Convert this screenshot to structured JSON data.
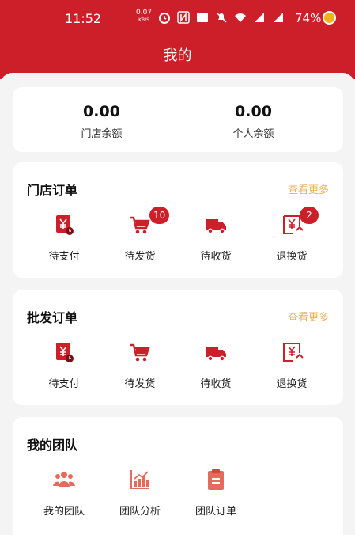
{
  "status_bar": {
    "time": "11:52",
    "net_speed_value": "0.07",
    "net_speed_unit": "KB/S",
    "battery": "74%"
  },
  "page_title": "我的",
  "balance": {
    "store_amount": "0.00",
    "store_label": "门店余额",
    "personal_amount": "0.00",
    "personal_label": "个人余额"
  },
  "store_orders": {
    "title": "门店订单",
    "more": "查看更多",
    "items": [
      {
        "label": "待支付",
        "icon": "pending-payment-icon",
        "badge": ""
      },
      {
        "label": "待发货",
        "icon": "cart-icon",
        "badge": "10"
      },
      {
        "label": "待收货",
        "icon": "truck-icon",
        "badge": ""
      },
      {
        "label": "退换货",
        "icon": "return-icon",
        "badge": "2"
      }
    ]
  },
  "wholesale_orders": {
    "title": "批发订单",
    "more": "查看更多",
    "items": [
      {
        "label": "待支付",
        "icon": "pending-payment-icon"
      },
      {
        "label": "待发货",
        "icon": "cart-icon"
      },
      {
        "label": "待收货",
        "icon": "truck-icon"
      },
      {
        "label": "退换货",
        "icon": "return-icon"
      }
    ]
  },
  "my_team": {
    "title": "我的团队",
    "items": [
      {
        "label": "我的团队",
        "icon": "team-icon"
      },
      {
        "label": "团队分析",
        "icon": "chart-icon"
      },
      {
        "label": "团队订单",
        "icon": "clipboard-icon"
      }
    ]
  },
  "colors": {
    "brand_red": "#cd1f2a",
    "more_link": "#e8b25f",
    "icon_light": "#e86a5c"
  }
}
